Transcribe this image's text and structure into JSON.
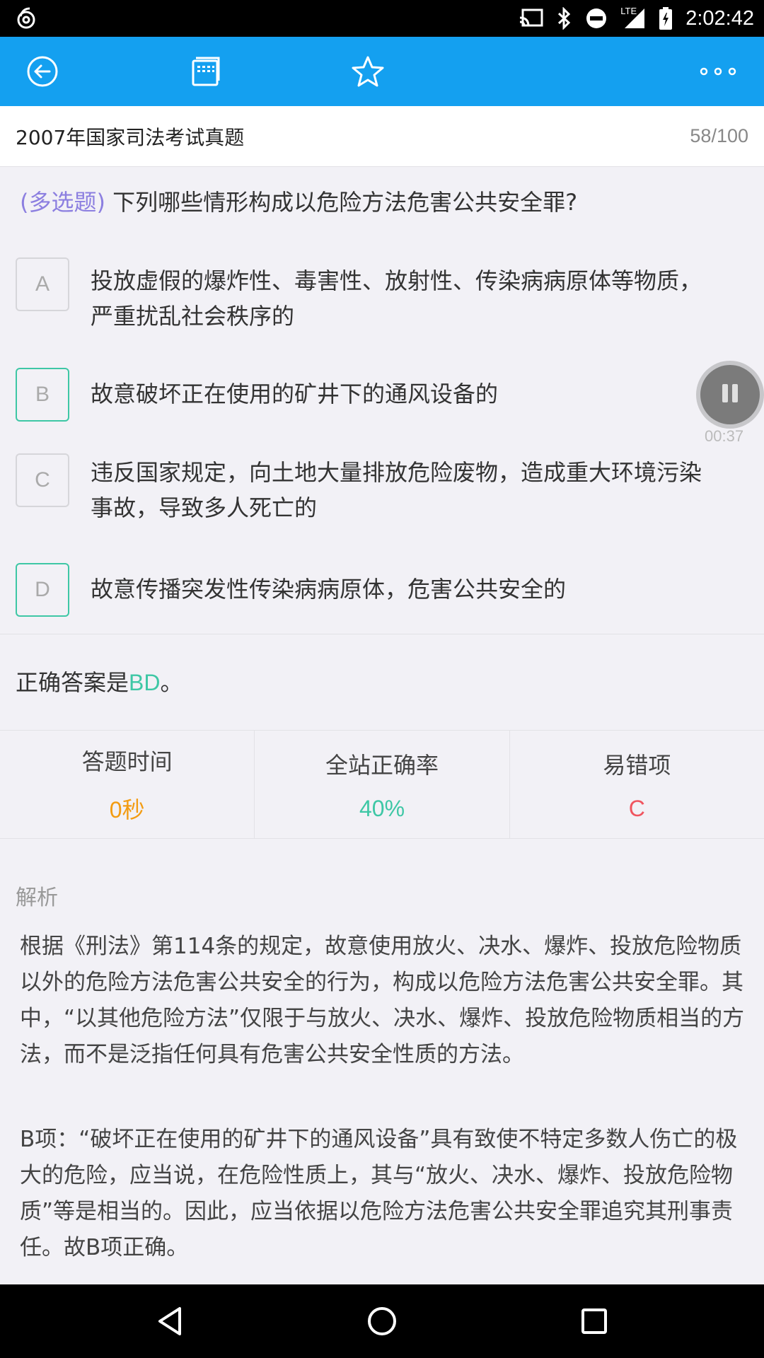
{
  "status_bar": {
    "time": "2:02:42",
    "network_label": "LTE",
    "icons": [
      "app-notification-icon",
      "cast-icon",
      "bluetooth-icon",
      "do-not-disturb-icon",
      "signal-icon",
      "battery-icon"
    ]
  },
  "toolbar": {
    "icons": [
      "back-icon",
      "answer-sheet-icon",
      "star-icon",
      "more-icon"
    ],
    "color": "#14a0f0"
  },
  "header": {
    "title": "2007年国家司法考试真题",
    "progress": "58/100"
  },
  "question": {
    "type_label": "(多选题)",
    "text": " 下列哪些情形构成以危险方法危害公共安全罪?"
  },
  "options": [
    {
      "letter": "A",
      "text": "投放虚假的爆炸性、毒害性、放射性、传染病病原体等物质，严重扰乱社会秩序的",
      "correct": false
    },
    {
      "letter": "B",
      "text": "故意破坏正在使用的矿井下的通风设备的",
      "correct": true
    },
    {
      "letter": "C",
      "text": "违反国家规定，向土地大量排放危险废物，造成重大环境污染事故，导致多人死亡的",
      "correct": false
    },
    {
      "letter": "D",
      "text": "故意传播突发性传染病病原体，危害公共安全的",
      "correct": true
    }
  ],
  "audio": {
    "elapsed": "00:37"
  },
  "answer": {
    "prefix": "正确答案是",
    "value": "BD",
    "suffix": "。"
  },
  "stats": [
    {
      "label": "答题时间",
      "value": "0秒",
      "color": "#f39c12"
    },
    {
      "label": "全站正确率",
      "value": "40%",
      "color": "#3ec7a5"
    },
    {
      "label": "易错项",
      "value": "C",
      "color": "#f0555f"
    }
  ],
  "analysis": {
    "heading": "解析",
    "paragraphs": [
      "根据《刑法》第114条的规定，故意使用放火、决水、爆炸、投放危险物质以外的危险方法危害公共安全的行为，构成以危险方法危害公共安全罪。其中，“以其他危险方法”仅限于与放火、决水、爆炸、投放危险物质相当的方法，而不是泛指任何具有危害公共安全性质的方法。",
      "B项：“破坏正在使用的矿井下的通风设备”具有致使不特定多数人伤亡的极大的危险，应当说，在危险性质上，其与“放火、决水、爆炸、投放危险物质”等是相当的。因此，应当依据以危险方法危害公共安全罪追究其刑事责任。故B项正确。"
    ]
  },
  "nav_bar": {
    "icons": [
      "back-triangle-icon",
      "home-circle-icon",
      "recents-square-icon"
    ]
  }
}
